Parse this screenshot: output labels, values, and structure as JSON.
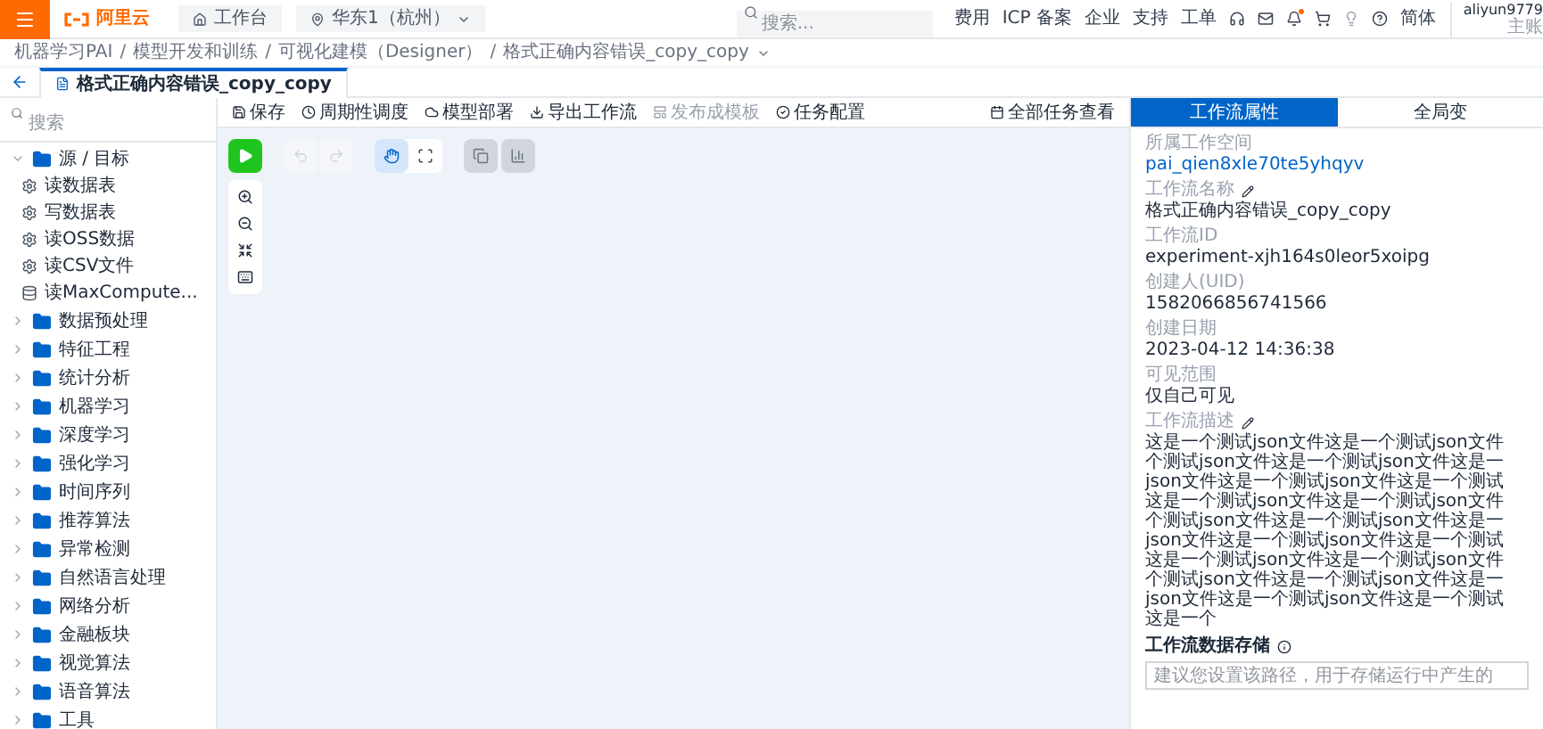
{
  "topbar": {
    "logo": "阿里云",
    "workbench": "工作台",
    "region": "华东1（杭州）",
    "search": {
      "placeholder": "搜索..."
    },
    "links": [
      "费用",
      "ICP 备案",
      "企业",
      "支持",
      "工单"
    ],
    "language": "简体",
    "user": {
      "name": "aliyun9779",
      "role": "主账"
    }
  },
  "breadcrumb": {
    "separator": "/",
    "items": [
      "机器学习PAI",
      "模型开发和训练",
      "可视化建模（Designer）",
      "格式正确内容错误_copy_copy"
    ]
  },
  "tabs": [
    {
      "label": "格式正确内容错误_copy_copy",
      "selected": true
    }
  ],
  "sidebar": {
    "search": {
      "placeholder": "搜索"
    },
    "tree": [
      {
        "label": "源 / 目标",
        "expanded": true,
        "children": [
          {
            "label": "读数据表"
          },
          {
            "label": "写数据表"
          },
          {
            "label": "读OSS数据"
          },
          {
            "label": "读CSV文件"
          },
          {
            "label": "读MaxCompute..."
          }
        ]
      },
      {
        "label": "数据预处理",
        "expanded": false
      },
      {
        "label": "特征工程",
        "expanded": false
      },
      {
        "label": "统计分析",
        "expanded": false
      },
      {
        "label": "机器学习",
        "expanded": false
      },
      {
        "label": "深度学习",
        "expanded": false
      },
      {
        "label": "强化学习",
        "expanded": false
      },
      {
        "label": "时间序列",
        "expanded": false
      },
      {
        "label": "推荐算法",
        "expanded": false
      },
      {
        "label": "异常检测",
        "expanded": false
      },
      {
        "label": "自然语言处理",
        "expanded": false
      },
      {
        "label": "网络分析",
        "expanded": false
      },
      {
        "label": "金融板块",
        "expanded": false
      },
      {
        "label": "视觉算法",
        "expanded": false
      },
      {
        "label": "语音算法",
        "expanded": false
      },
      {
        "label": "工具",
        "expanded": false
      }
    ]
  },
  "toolbar": {
    "actions": [
      {
        "kind": "save",
        "label": "保存",
        "disabled": false
      },
      {
        "kind": "schedule",
        "label": "周期性调度",
        "disabled": false
      },
      {
        "kind": "deploy",
        "label": "模型部署",
        "disabled": false
      },
      {
        "kind": "export",
        "label": "导出工作流",
        "disabled": false
      },
      {
        "kind": "template",
        "label": "发布成模板",
        "disabled": true
      },
      {
        "kind": "config",
        "label": "任务配置",
        "disabled": false
      }
    ],
    "task_view": "全部任务查看"
  },
  "canvas": {
    "undo": {
      "disabled": true
    },
    "redo": {
      "disabled": true
    },
    "tools": [
      {
        "kind": "hand",
        "selected": true
      },
      {
        "kind": "frame",
        "selected": false
      }
    ]
  },
  "panel": {
    "tabs": [
      {
        "label": "工作流属性",
        "selected": true
      },
      {
        "label": "全局变",
        "selected": false
      }
    ],
    "fields": [
      {
        "label": "所属工作空间",
        "value": "pai_qien8xle70te5yhqyv",
        "kind": "link",
        "editable": false
      },
      {
        "label": "工作流名称",
        "value": "格式正确内容错误_copy_copy",
        "kind": "text",
        "editable": true
      },
      {
        "label": "工作流ID",
        "value": "experiment-xjh164s0leor5xoipg",
        "kind": "text",
        "editable": false
      },
      {
        "label": "创建人(UID)",
        "value": "1582066856741566",
        "kind": "text",
        "editable": false
      },
      {
        "label": "创建日期",
        "value": "2023-04-12 14:36:38",
        "kind": "text",
        "editable": false
      },
      {
        "label": "可见范围",
        "value": "仅自己可见",
        "kind": "text",
        "editable": false
      }
    ],
    "description": {
      "label": "工作流描述",
      "editable": true,
      "lines": [
        "这是一个测试json文件这是一个测试json文件",
        "个测试json文件这是一个测试json文件这是一",
        "json文件这是一个测试json文件这是一个测试",
        "这是一个测试json文件这是一个测试json文件",
        "个测试json文件这是一个测试json文件这是一",
        "json文件这是一个测试json文件这是一个测试",
        "这是一个测试json文件这是一个测试json文件",
        "个测试json文件这是一个测试json文件这是一",
        "json文件这是一个测试json文件这是一个测试",
        "这是一个"
      ]
    },
    "storage": {
      "label": "工作流数据存储",
      "placeholder": "建议您设置该路径，用于存储运行中产生的"
    }
  }
}
